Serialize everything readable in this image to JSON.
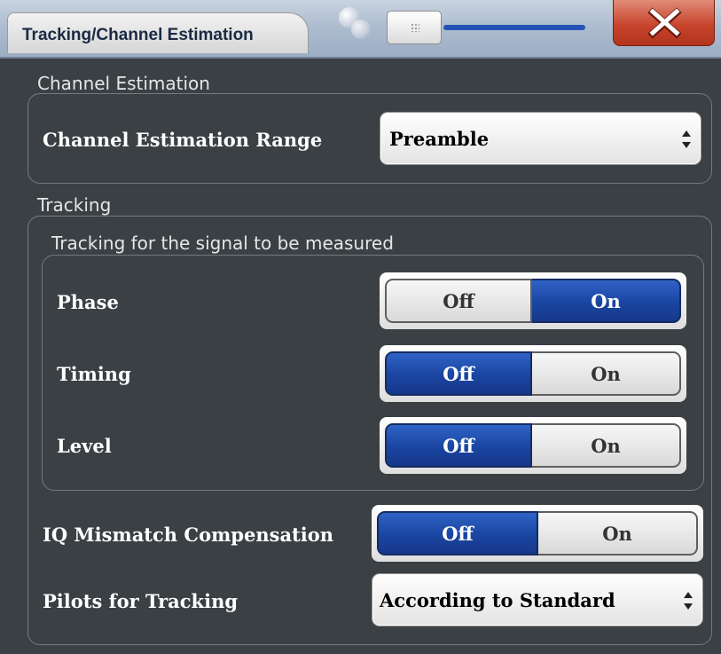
{
  "dialog": {
    "title": "Tracking/Channel Estimation",
    "close_label": "X"
  },
  "channel_estimation": {
    "section_label": "Channel Estimation",
    "range_label": "Channel Estimation Range",
    "range_value": "Preamble"
  },
  "tracking": {
    "section_label": "Tracking",
    "subgroup_label": "Tracking for the signal to be measured",
    "phase": {
      "label": "Phase",
      "off_label": "Off",
      "on_label": "On",
      "selected": "On"
    },
    "timing": {
      "label": "Timing",
      "off_label": "Off",
      "on_label": "On",
      "selected": "Off"
    },
    "level": {
      "label": "Level",
      "off_label": "Off",
      "on_label": "On",
      "selected": "Off"
    },
    "iq_mismatch": {
      "label": "IQ Mismatch Compensation",
      "off_label": "Off",
      "on_label": "On",
      "selected": "Off"
    },
    "pilots": {
      "label": "Pilots for Tracking",
      "value": "According to Standard"
    }
  },
  "colors": {
    "active_toggle": "#1f4fae",
    "close_button": "#c8452d",
    "panel_background": "#3a4043"
  },
  "icons": {
    "close": "close-icon",
    "dropdown": "spinner-arrows-icon"
  }
}
